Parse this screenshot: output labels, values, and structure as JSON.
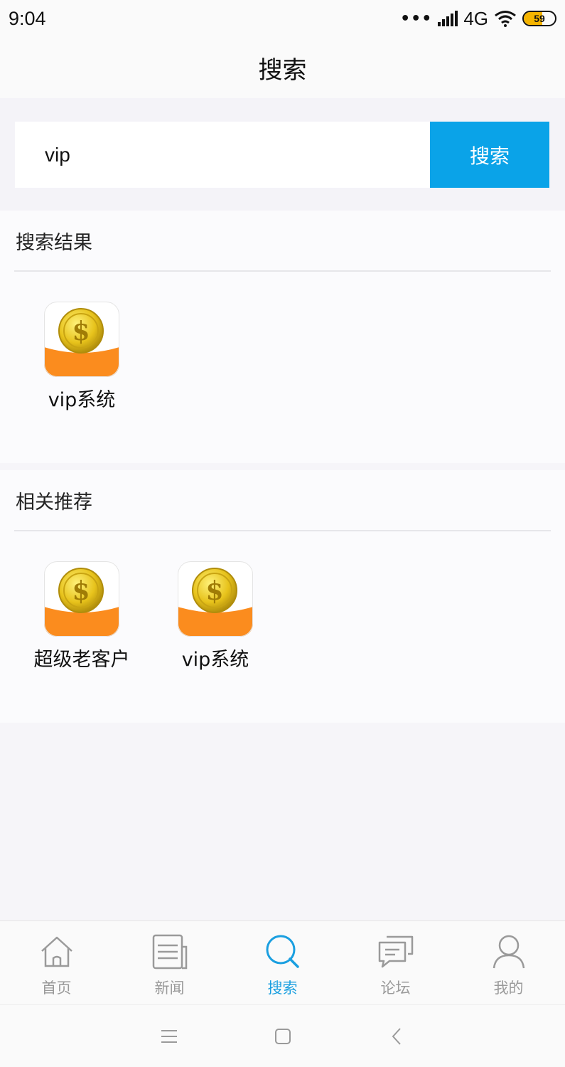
{
  "status_bar": {
    "time": "9:04",
    "network": "4G",
    "battery": "59"
  },
  "header": {
    "title": "搜索"
  },
  "search": {
    "value": "vip",
    "button_label": "搜索"
  },
  "results": {
    "title": "搜索结果",
    "items": [
      {
        "name": "vip系统",
        "icon": "coin-app-icon"
      }
    ]
  },
  "recommend": {
    "title": "相关推荐",
    "items": [
      {
        "name": "超级老客户",
        "icon": "coin-app-icon"
      },
      {
        "name": "vip系统",
        "icon": "coin-app-icon"
      }
    ]
  },
  "tabbar": {
    "items": [
      {
        "label": "首页",
        "icon": "home-icon"
      },
      {
        "label": "新闻",
        "icon": "news-icon"
      },
      {
        "label": "搜索",
        "icon": "search-icon",
        "active": true
      },
      {
        "label": "论坛",
        "icon": "forum-icon"
      },
      {
        "label": "我的",
        "icon": "profile-icon"
      }
    ]
  },
  "colors": {
    "accent": "#0aa3e8",
    "tab_active": "#1a9fe0",
    "tab_inactive": "#9a9a9a",
    "app_icon_orange": "#fb8c1e",
    "coin_gold": "#e8c21a"
  }
}
